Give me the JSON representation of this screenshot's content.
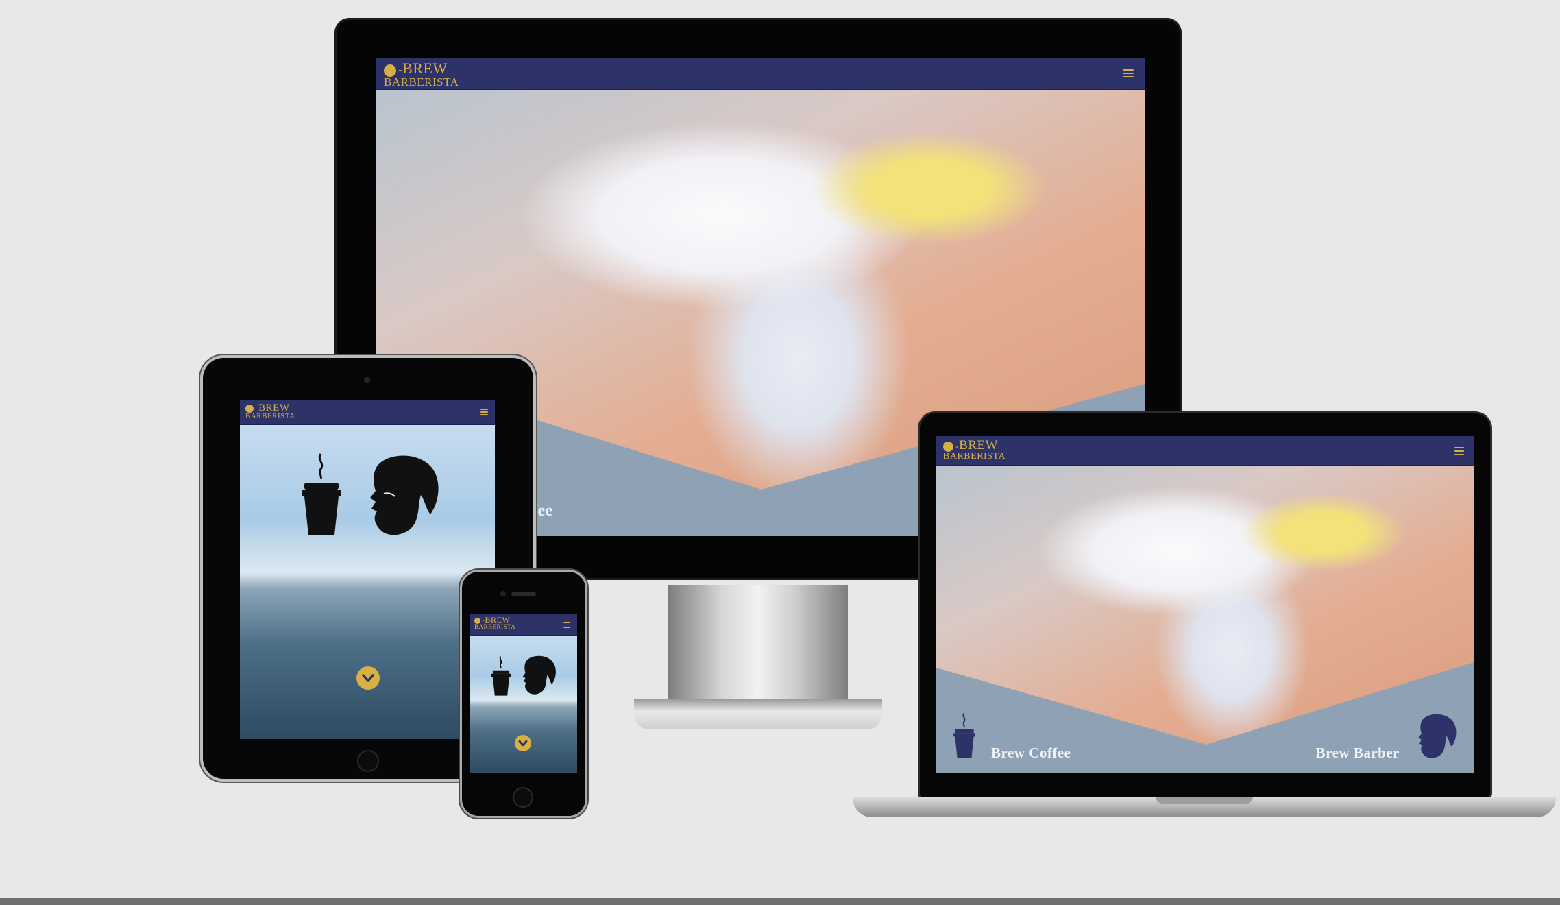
{
  "brand": {
    "name_top": "BREW",
    "name_bottom": "BARBERISTA",
    "navbar_color": "#2d3268",
    "accent_color": "#d4b04a"
  },
  "desktop": {
    "hero_caption_partial": "fee"
  },
  "laptop": {
    "left_label": "Brew Coffee",
    "right_label": "Brew Barber"
  },
  "icons": [
    "coffee-cup-icon",
    "bearded-man-icon",
    "hamburger-menu-icon",
    "chevron-down-icon"
  ]
}
